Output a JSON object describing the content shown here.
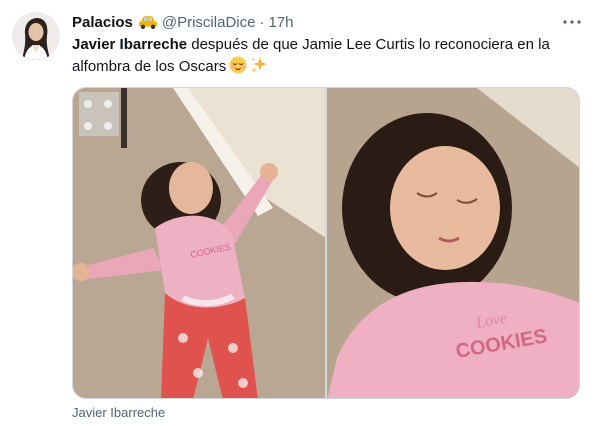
{
  "tweet": {
    "display_name": "Palacios",
    "name_emoji": "car-icon",
    "handle": "@PriscilaDice",
    "separator": "·",
    "timestamp": "17h",
    "text_bold": "Javier Ibarreche",
    "text_rest": " después de que Jamie Lee Curtis lo reconociera en la alfombra de los Oscars",
    "text_emojis": [
      "relieved-face-emoji",
      "sparkles-emoji"
    ],
    "media_caption": "Javier Ibarreche",
    "more_icon": "more-horizontal-icon",
    "photos": [
      "photo-girl-lying-on-carpet",
      "photo-girl-closeup"
    ]
  },
  "colors": {
    "text_primary": "#0f1419",
    "text_secondary": "#536471",
    "border": "#cfd9de"
  }
}
